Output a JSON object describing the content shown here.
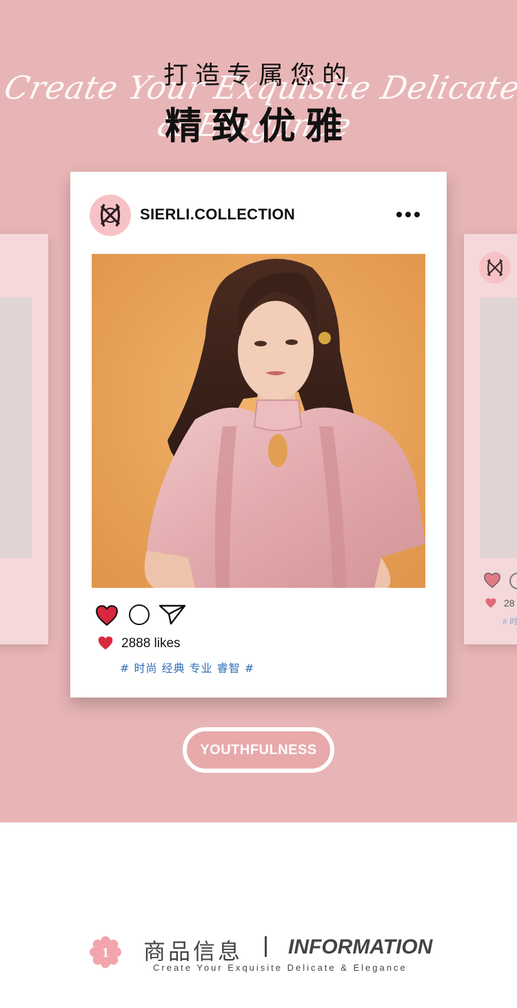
{
  "hero": {
    "title_line1": "打造专属您的",
    "script_text": "Create Your Exquisite Delicate & Elegance",
    "title_line2": "精致优雅"
  },
  "post": {
    "username": "SIERLI.COLLECTION",
    "likes": "2888 likes",
    "tags": "# 时尚 经典 专业 睿智 #",
    "photo_icon": "model-photo"
  },
  "side_card": {
    "likes_partial": "28",
    "tags_partial": "# 时"
  },
  "pill": {
    "label": "YOUTHFULNESS"
  },
  "section": {
    "number": "1",
    "title_cn": "商品信息",
    "title_en": "INFORMATION",
    "subtitle": "Create Your Exquisite Delicate & Elegance"
  },
  "colors": {
    "hero_bg": "#e8b5b6",
    "heart_red": "#d8283d",
    "tag_blue": "#2f6dbb",
    "avatar_pink": "#f7c2c6",
    "pill_fill": "#e8a9ab"
  }
}
